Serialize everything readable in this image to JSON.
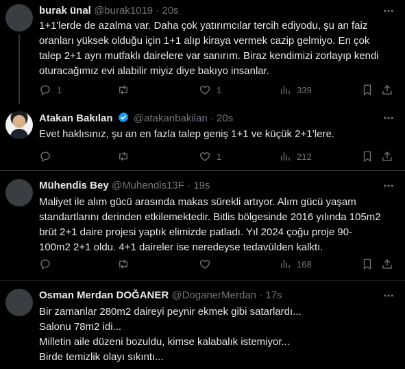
{
  "tweets": [
    {
      "name": "burak ünal",
      "handle": "@burak1019",
      "time": "20s",
      "text": "1+1'lerde de azalma var. Daha çok yatırımcılar tercih ediyodu, şu an faiz\noranları yüksek olduğu için 1+1 alıp kiraya vermek cazip gelmiyo. En çok\ntalep 2+1 ayrı mutfaklı dairelere var sanırım. Biraz kendimizi zorlayıp kendi\noturacağımız evi alabilir miyiz diye bakıyo insanlar.",
      "replies": "1",
      "retweets": "",
      "likes": "1",
      "views": "339"
    },
    {
      "name": "Atakan Bakılan",
      "handle": "@atakanbakilan",
      "time": "20s",
      "verified": true,
      "text": "Evet haklısınız, şu an en fazla talep geniş 1+1 ve küçük 2+1’lere.",
      "replies": "",
      "retweets": "",
      "likes": "1",
      "views": "212"
    },
    {
      "name": "Mühendis Bey",
      "handle": "@Muhendis13F",
      "time": "19s",
      "text": "Maliyet ile alım gücü arasında makas sürekli artıyor. Alım gücü yaşam\nstandartlarını derinden etkilemektedir. Bitlis bölgesinde 2016 yılında 105m2\nbrüt 2+1 daire projesi yaptık elimizde patladı. Yıl 2024 çoğu proje 90-\n100m2 2+1 oldu. 4+1 daireler ise neredeyse tedavülden kalktı.",
      "replies": "",
      "retweets": "",
      "likes": "",
      "views": "168"
    },
    {
      "name": "Osman Merdan DOĞANER",
      "handle": "@DoganerMerdan",
      "time": "17s",
      "text": "Bir zamanlar 280m2 daireyi peynir ekmek gibi satarlardı...\nSalonu 78m2 idi...\nMilletin aile düzeni bozuldu, kimse kalabalık istemiyor...\nBirde temizlik olayı sıkıntı..."
    }
  ],
  "separator": "·",
  "icons": {
    "reply": "reply-icon",
    "retweet": "retweet-icon",
    "like": "like-icon",
    "views": "views-icon",
    "bookmark": "bookmark-icon",
    "share": "share-icon",
    "more": "more-icon",
    "verified": "verified-badge-icon"
  },
  "colors": {
    "background": "#000000",
    "text": "#e7e9ea",
    "secondary": "#71767b",
    "border": "#2f3336",
    "verified": "#1d9bf0"
  }
}
